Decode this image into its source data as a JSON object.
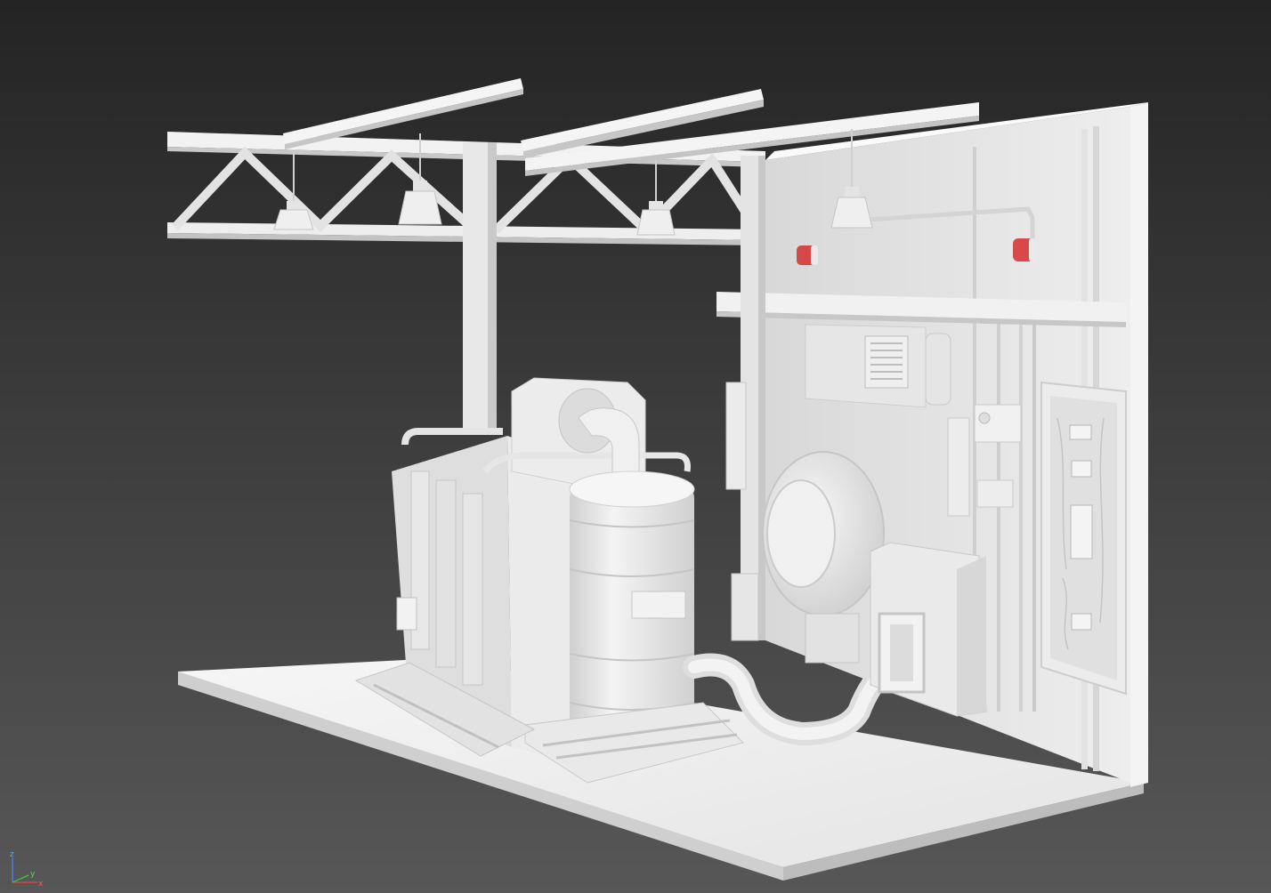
{
  "app": {
    "view": "3D viewport",
    "shading": "clay"
  },
  "colors": {
    "bg_top": "#262626",
    "bg_bottom": "#565656",
    "clay_light": "#f2f2f2",
    "clay_mid": "#dcdcdc",
    "clay_shadow": "#b9b9b9",
    "clay_dark": "#9a9a9a",
    "alarm_red": "#d23a3a",
    "axis_x": "#e04040",
    "axis_y": "#40c040",
    "axis_z": "#4a7ee0"
  },
  "axis_gizmo": {
    "z_label": "z",
    "y_label": "y",
    "x_label": "x"
  }
}
